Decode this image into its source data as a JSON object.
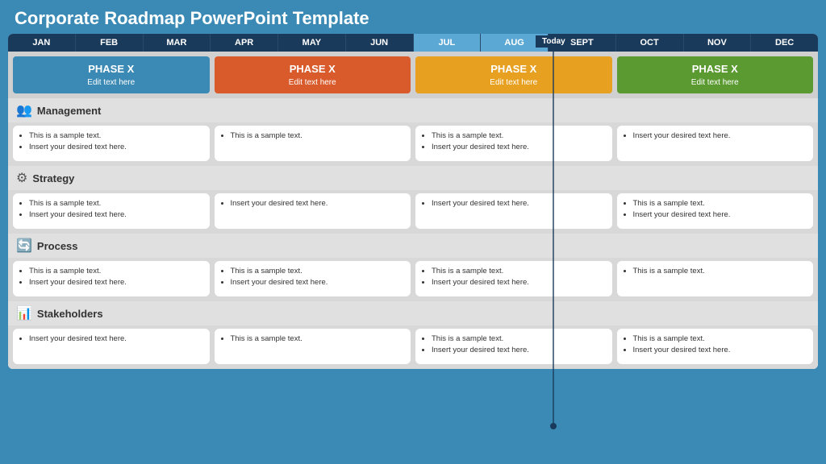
{
  "title": "Corporate Roadmap PowerPoint Template",
  "today_label": "Today",
  "months": [
    {
      "label": "JAN",
      "highlight": false
    },
    {
      "label": "FEB",
      "highlight": false
    },
    {
      "label": "MAR",
      "highlight": false
    },
    {
      "label": "APR",
      "highlight": false
    },
    {
      "label": "MAY",
      "highlight": false
    },
    {
      "label": "JUN",
      "highlight": false
    },
    {
      "label": "JUL",
      "highlight": true
    },
    {
      "label": "AUG",
      "highlight": true
    },
    {
      "label": "SEPT",
      "highlight": false
    },
    {
      "label": "OCT",
      "highlight": false
    },
    {
      "label": "NOV",
      "highlight": false
    },
    {
      "label": "DEC",
      "highlight": false
    }
  ],
  "phases": [
    {
      "label": "PHASE X",
      "sub": "Edit text here",
      "color": "phase-blue"
    },
    {
      "label": "PHASE X",
      "sub": "Edit text here",
      "color": "phase-orange"
    },
    {
      "label": "PHASE X",
      "sub": "Edit text here",
      "color": "phase-yellow"
    },
    {
      "label": "PHASE X",
      "sub": "Edit text here",
      "color": "phase-green"
    }
  ],
  "categories": [
    {
      "icon": "👥",
      "title": "Management",
      "cells": [
        [
          "This is a sample text.",
          "Insert your desired text here."
        ],
        [
          "This is a sample text."
        ],
        [
          "This is a sample text.",
          "Insert your desired text here."
        ],
        [
          "Insert your desired text here."
        ]
      ]
    },
    {
      "icon": "⚙",
      "title": "Strategy",
      "cells": [
        [
          "This is a sample text.",
          "Insert your desired text here."
        ],
        [
          "Insert your desired text here."
        ],
        [
          "Insert your desired text here."
        ],
        [
          "This is a sample text.",
          "Insert your desired text here."
        ]
      ]
    },
    {
      "icon": "🔄",
      "title": "Process",
      "cells": [
        [
          "This is a sample text.",
          "Insert your desired text here."
        ],
        [
          "This is a sample text.",
          "Insert your desired text here."
        ],
        [
          "This is a sample text.",
          "Insert your desired text here."
        ],
        [
          "This is a sample text."
        ]
      ]
    },
    {
      "icon": "📊",
      "title": "Stakeholders",
      "cells": [
        [
          "Insert your desired text here."
        ],
        [
          "This is a sample text."
        ],
        [
          "This is a sample text.",
          "Insert your desired text here."
        ],
        [
          "This is a sample text.",
          "Insert your desired text here."
        ]
      ]
    }
  ]
}
